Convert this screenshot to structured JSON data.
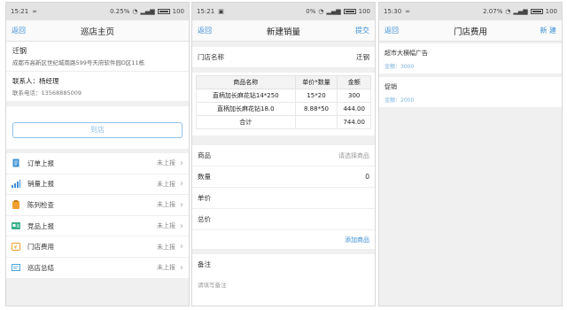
{
  "screen1": {
    "status": {
      "time": "15:21",
      "percent": "0.25%",
      "battery": "100"
    },
    "nav": {
      "back": "返回",
      "title": "巡店主页"
    },
    "store": {
      "name": "迁钢",
      "address": "成都市高新区世纪城南路599号天府软件园D区11栋"
    },
    "contact": {
      "name": "联系人：杨经理",
      "phone": "联系电话：13568885009"
    },
    "checkin": "到店",
    "menu": [
      {
        "label": "订单上报",
        "status": "未上报",
        "icon": "document-icon",
        "color": "#3c8fd6"
      },
      {
        "label": "销量上报",
        "status": "未上报",
        "icon": "bar-chart-icon",
        "color": "#3c8fd6"
      },
      {
        "label": "陈列检查",
        "status": "未上报",
        "icon": "clipboard-icon",
        "color": "#f0a030"
      },
      {
        "label": "竞品上报",
        "status": "未上报",
        "icon": "id-card-icon",
        "color": "#3ab08c"
      },
      {
        "label": "门店费用",
        "status": "未上报",
        "icon": "coupon-icon",
        "color": "#f0a030"
      },
      {
        "label": "巡店总结",
        "status": "未上报",
        "icon": "summary-icon",
        "color": "#4aa6d8"
      }
    ]
  },
  "screen2": {
    "status": {
      "time": "15:21",
      "percent": "0%",
      "battery": "100"
    },
    "nav": {
      "back": "返回",
      "title": "新建销量",
      "action": "提交"
    },
    "store_label": "门店名称",
    "store_value": "迁钢",
    "table": {
      "headers": [
        "商品名称",
        "单价*数量",
        "金额"
      ],
      "rows": [
        [
          "直柄加长麻花钻14*250",
          "15*20",
          "300"
        ],
        [
          "直柄加长麻花钻18.0",
          "8.88*50",
          "444.00"
        ]
      ],
      "total_label": "合计",
      "total_value": "744.00"
    },
    "fields": {
      "product_label": "商品",
      "product_placeholder": "请选择商品",
      "qty_label": "数量",
      "qty_value": "0",
      "price_label": "单价",
      "total_label": "总价"
    },
    "add_product": "添加商品",
    "note": {
      "label": "备注",
      "placeholder": "请填写备注"
    }
  },
  "screen3": {
    "status": {
      "time": "15:30",
      "percent": "2.07%",
      "battery": "100"
    },
    "nav": {
      "back": "返回",
      "title": "门店费用",
      "action": "新 建"
    },
    "items": [
      {
        "name": "超市大横幅广告",
        "amount": "金额：3000"
      },
      {
        "name": "促销",
        "amount": "金额：2000"
      }
    ]
  }
}
